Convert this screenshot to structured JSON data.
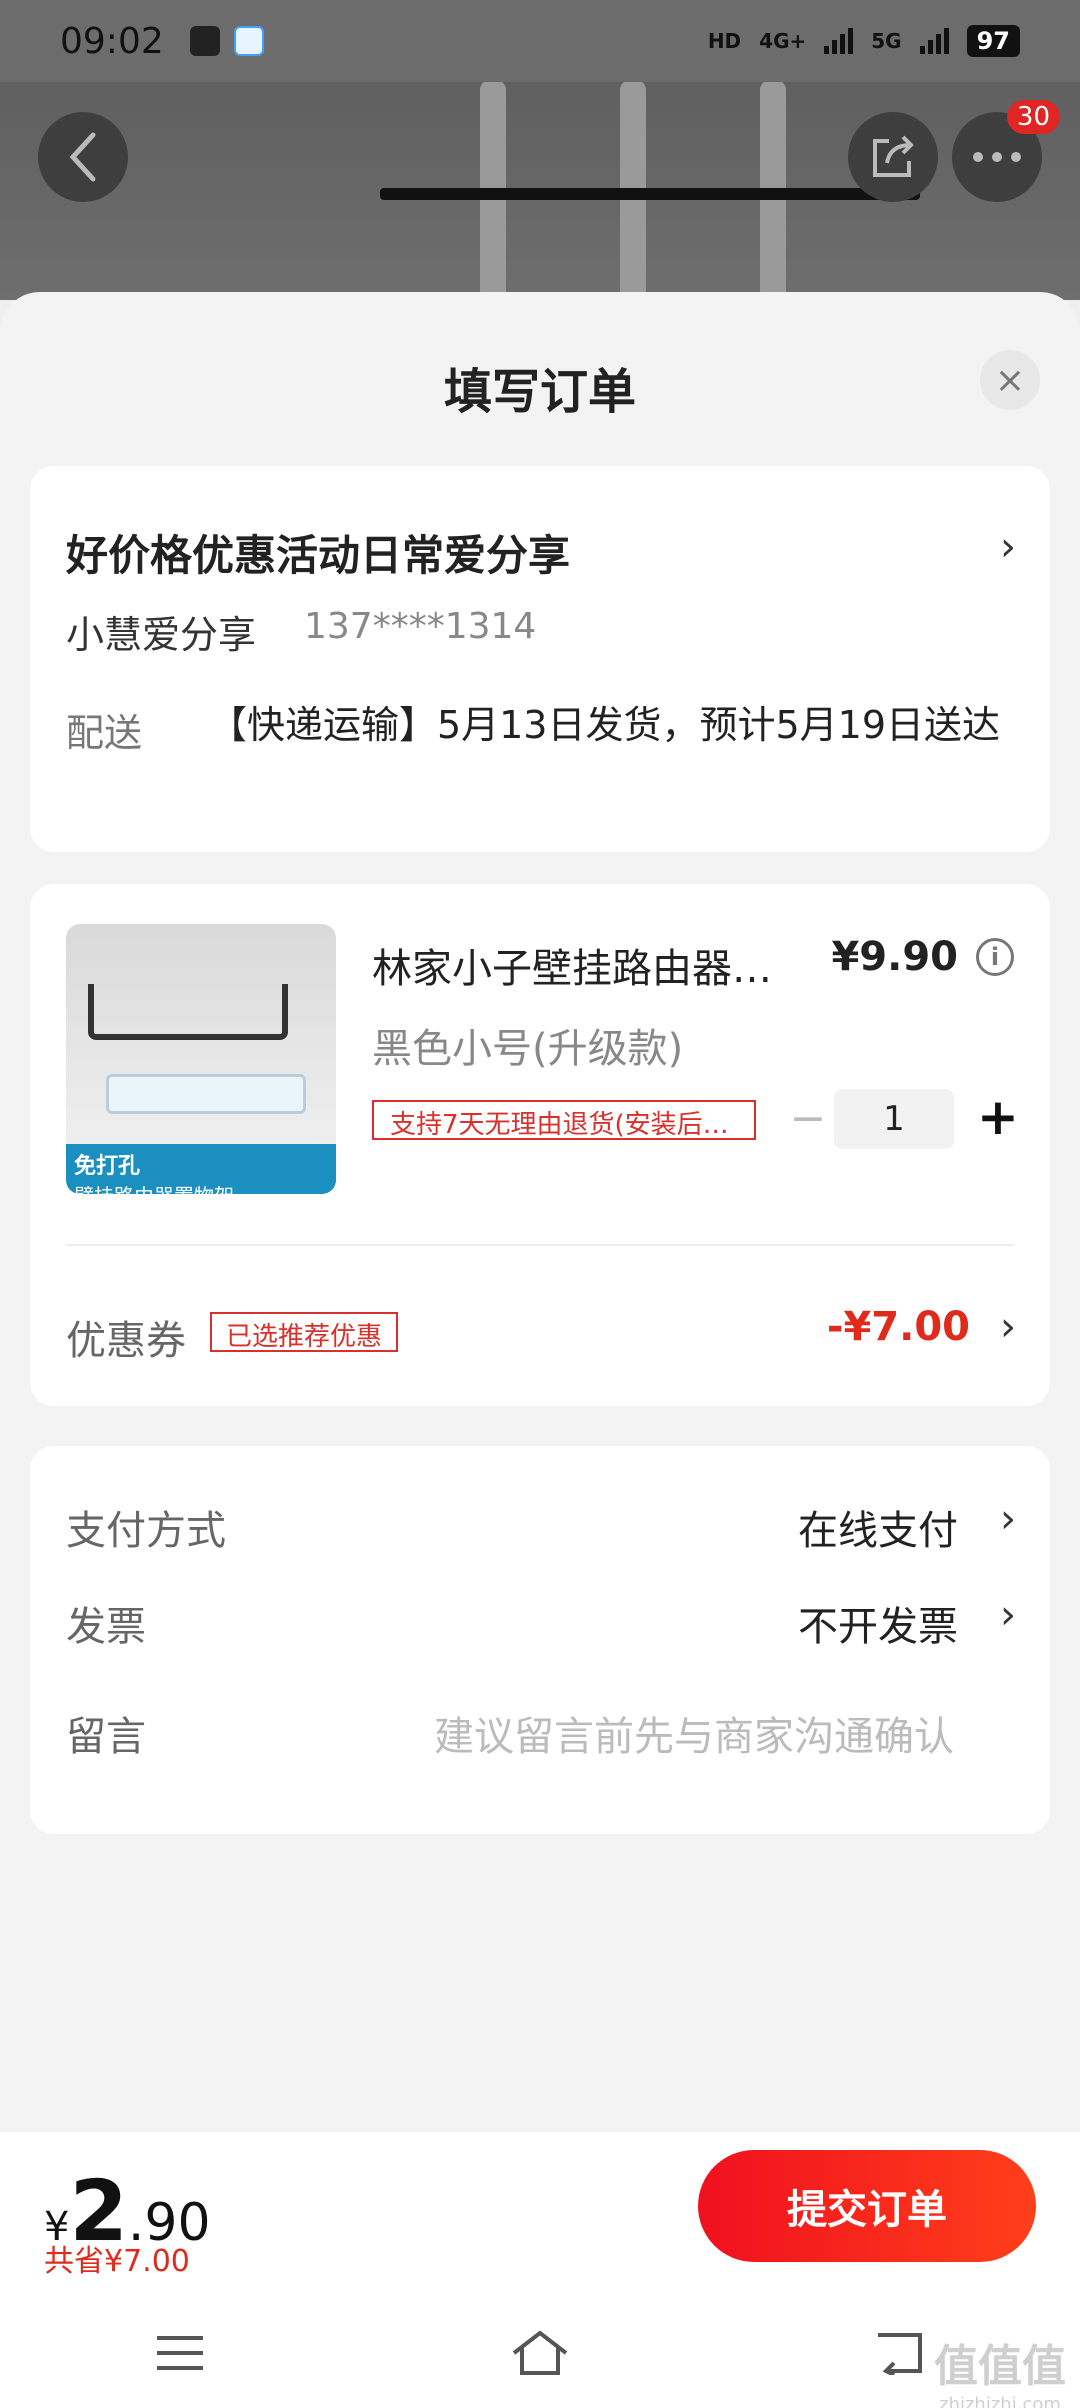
{
  "status_bar": {
    "time": "09:02",
    "hd_label": "HD",
    "net1": "4G+",
    "net2": "5G",
    "battery": "97"
  },
  "top_bar": {
    "badge_count": "30"
  },
  "sheet": {
    "title": "填写订单",
    "close_icon": "×"
  },
  "address": {
    "name": "好价格优惠活动日常爱分享",
    "recipient": "小慧爱分享",
    "phone": "137****1314",
    "shipping_label": "配送",
    "shipping_text": "【快递运输】5月13日发货，预计5月19日送达"
  },
  "product": {
    "thumb_tag": "免打孔",
    "thumb_caption": "壁挂路由器置物架",
    "name": "林家小子壁挂路由器…",
    "price": "¥9.90",
    "spec": "黑色小号(升级款)",
    "return_tag": "支持7天无理由退货(安装后…",
    "quantity": "1",
    "coupon_label": "优惠券",
    "coupon_tag": "已选推荐优惠",
    "coupon_amount": "-¥7.00"
  },
  "options": {
    "payment_label": "支付方式",
    "payment_value": "在线支付",
    "invoice_label": "发票",
    "invoice_value": "不开发票",
    "message_label": "留言",
    "message_placeholder": "建议留言前先与商家沟通确认"
  },
  "footer": {
    "currency": "¥",
    "total_int": "2",
    "total_dec": ".90",
    "saved": "共省¥7.00",
    "submit_label": "提交订单"
  },
  "watermark": {
    "main": "值值值",
    "sub": "zhizhizhi.com"
  },
  "colors": {
    "accent": "#e02a1c",
    "submit_start": "#f0101e",
    "submit_end": "#ff3f1a"
  }
}
